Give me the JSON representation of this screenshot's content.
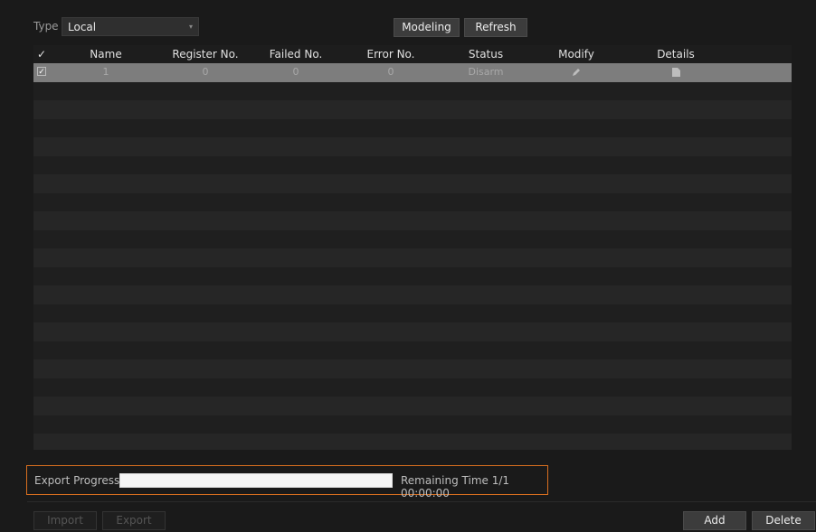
{
  "filter": {
    "type_label": "Type",
    "type_value": "Local",
    "dropdown_arrow": "▾"
  },
  "toolbar": {
    "modeling_label": "Modeling",
    "refresh_label": "Refresh"
  },
  "table": {
    "header_check": "✓",
    "columns": [
      "Name",
      "Register No.",
      "Failed No.",
      "Error No.",
      "Status",
      "Modify",
      "Details"
    ],
    "rows": [
      {
        "checked": "✓",
        "name": "1",
        "register": "0",
        "failed": "0",
        "error": "0",
        "status": "Disarm",
        "modify_icon": "edit-icon",
        "details_icon": "document-icon"
      }
    ]
  },
  "export": {
    "progress_label": "Export Progress",
    "progress_fraction": 1.0,
    "remaining_text": "Remaining Time 1/1 00:00:00",
    "highlight_color": "#d86e1f"
  },
  "footer": {
    "import_label": "Import",
    "export_label": "Export",
    "add_label": "Add",
    "delete_label": "Delete"
  }
}
